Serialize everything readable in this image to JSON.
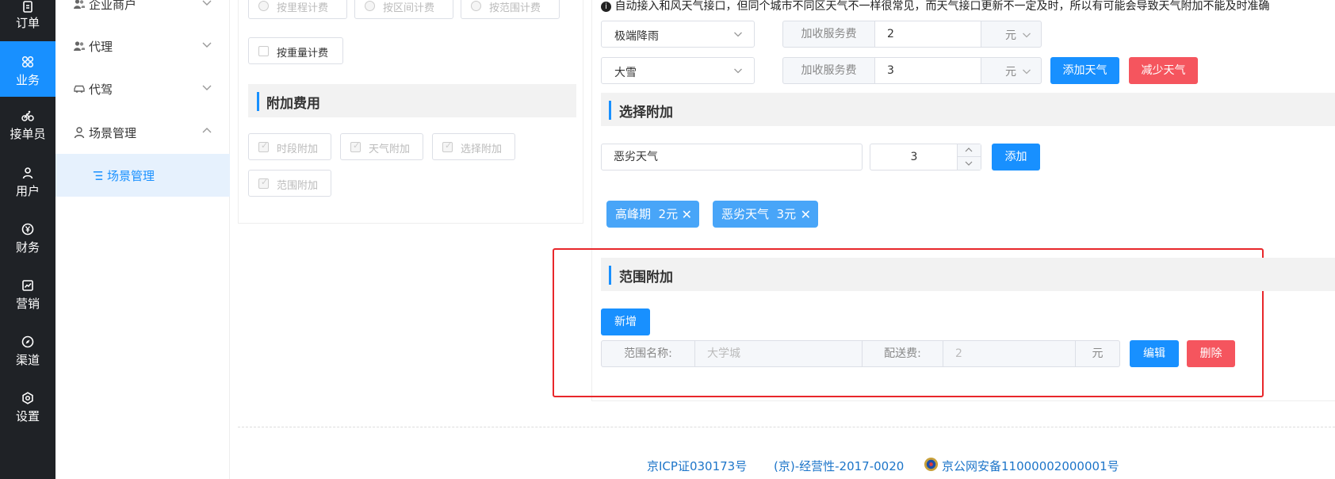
{
  "rail": {
    "items": [
      {
        "label": "订单",
        "icon": "clipboard-icon"
      },
      {
        "label": "业务",
        "icon": "grid-icon"
      },
      {
        "label": "接单员",
        "icon": "bike-icon"
      },
      {
        "label": "用户",
        "icon": "user-icon"
      },
      {
        "label": "财务",
        "icon": "yen-coin-icon"
      },
      {
        "label": "营销",
        "icon": "chart-icon"
      },
      {
        "label": "渠道",
        "icon": "compass-icon"
      },
      {
        "label": "设置",
        "icon": "gear-icon"
      }
    ],
    "active_color": "#1890ff"
  },
  "submenu": {
    "items": [
      {
        "label": "企业商户",
        "icon": "users-icon"
      },
      {
        "label": "代理",
        "icon": "users-icon"
      },
      {
        "label": "代驾",
        "icon": "car-icon"
      },
      {
        "label": "场景管理",
        "icon": "user-icon"
      }
    ],
    "child": {
      "label": "场景管理",
      "icon": "list-icon"
    }
  },
  "billing": {
    "radios": [
      "按里程计费",
      "按区间计费",
      "按范围计费"
    ],
    "weight_checkbox": "按重量计费",
    "extra_section_title": "附加费用",
    "extra_options": [
      "时段附加",
      "天气附加",
      "选择附加",
      "范围附加"
    ]
  },
  "weather": {
    "notice": "自动接入和风天气接口，但同个城市不同区天气不一样很常见，而天气接口更新不一定及时，所以有可能会导致天气附加不能及时准确",
    "rows": [
      {
        "weather": "极端降雨",
        "label": "加收服务费",
        "amount": "2",
        "unit": "元"
      },
      {
        "weather": "大雪",
        "label": "加收服务费",
        "amount": "3",
        "unit": "元"
      }
    ],
    "add_button": "添加天气",
    "remove_button": "减少天气"
  },
  "select_addon": {
    "title": "选择附加",
    "name_value": "恶劣天气",
    "amount_value": "3",
    "add_button": "添加",
    "tags": [
      {
        "label": "高峰期  2元"
      },
      {
        "label": "恶劣天气  3元"
      }
    ]
  },
  "range_addon": {
    "title": "范围附加",
    "new_button": "新增",
    "name_label": "范围名称:",
    "name_placeholder": "大学城",
    "fee_label": "配送费:",
    "fee_placeholder": "2",
    "unit": "元",
    "edit_button": "编辑",
    "delete_button": "删除"
  },
  "footer": {
    "icp": "京ICP证030173号",
    "license": "(京)-经营性-2017-0020",
    "police": "京公网安备11000002000001号"
  },
  "colors": {
    "primary": "#1890ff",
    "danger": "#f5555e",
    "highlight_border": "#e8272b"
  }
}
